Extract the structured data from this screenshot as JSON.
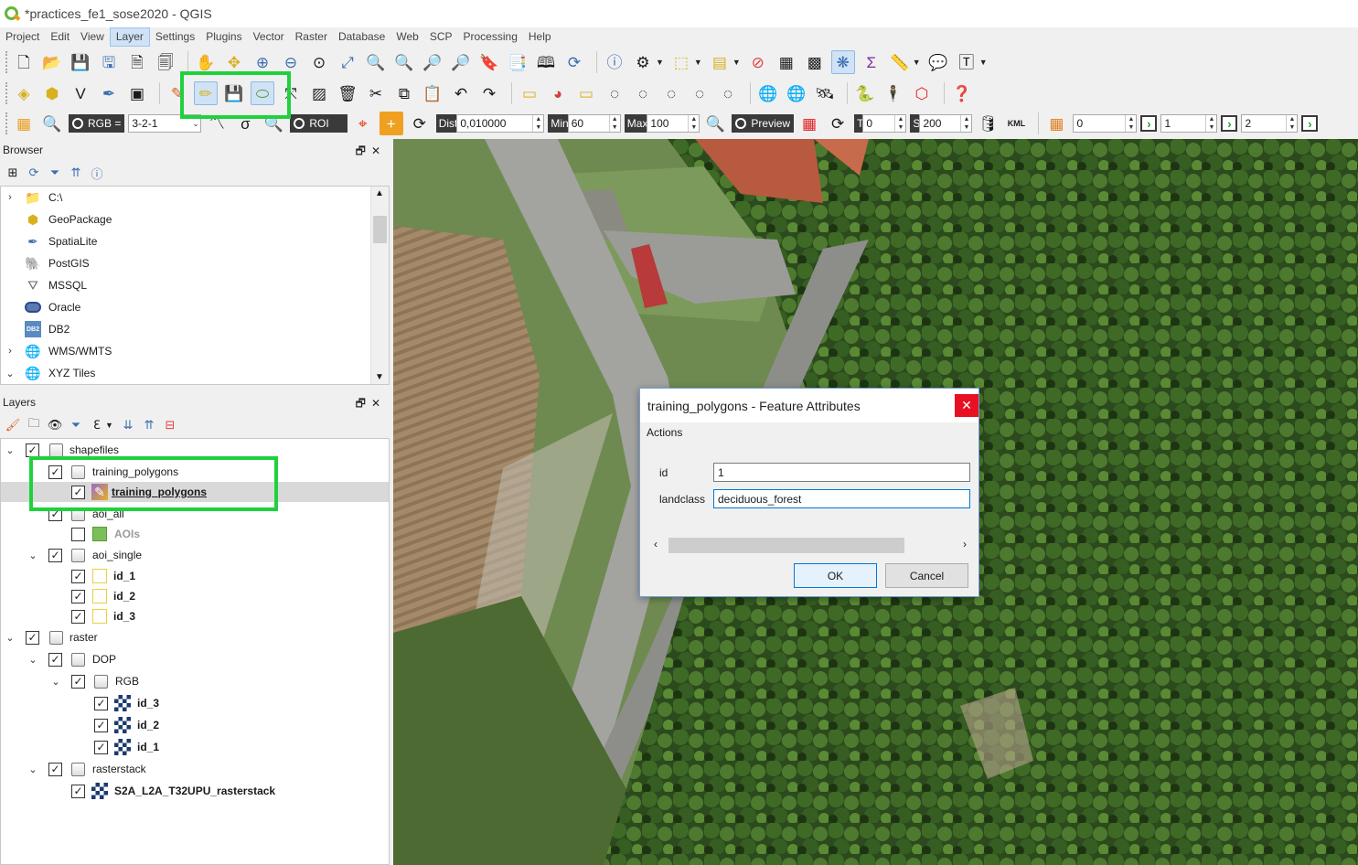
{
  "window": {
    "title": "*practices_fe1_sose2020 - QGIS"
  },
  "menu": [
    "Project",
    "Edit",
    "View",
    "Layer",
    "Settings",
    "Plugins",
    "Vector",
    "Raster",
    "Database",
    "Web",
    "SCP",
    "Processing",
    "Help"
  ],
  "menu_active": "Layer",
  "scp_toolbar": {
    "rgb_label": "RGB =",
    "rgb_value": "3-2-1",
    "roi_label": "ROI",
    "dist_label": "Dist",
    "dist_value": "0,010000",
    "min_label": "Min",
    "min_value": "60",
    "max_label": "Max",
    "max_value": "100",
    "preview_label": "Preview",
    "t_label": "T",
    "t_value": "0",
    "s_label": "S",
    "s_value": "200",
    "kml_label": "KML",
    "band_values": [
      "0",
      "1",
      "2"
    ]
  },
  "browser": {
    "title": "Browser",
    "items": [
      {
        "label": "C:\\",
        "icon": "folder-icon",
        "expander": "›"
      },
      {
        "label": "GeoPackage",
        "icon": "geopackage-icon",
        "expander": ""
      },
      {
        "label": "SpatiaLite",
        "icon": "spatialite-icon",
        "expander": ""
      },
      {
        "label": "PostGIS",
        "icon": "postgis-icon",
        "expander": ""
      },
      {
        "label": "MSSQL",
        "icon": "mssql-icon",
        "expander": ""
      },
      {
        "label": "Oracle",
        "icon": "oracle-icon",
        "expander": ""
      },
      {
        "label": "DB2",
        "icon": "db2-icon",
        "expander": ""
      },
      {
        "label": "WMS/WMTS",
        "icon": "globe-icon",
        "expander": "›"
      },
      {
        "label": "XYZ Tiles",
        "icon": "globe-icon",
        "expander": "⌄"
      }
    ],
    "db2_badge": "DB2"
  },
  "layers": {
    "title": "Layers",
    "tree": {
      "shapefiles": "shapefiles",
      "training_group": "training_polygons",
      "training_layer": "training_polygons",
      "aoi_all": "aoi_all",
      "aois": "AOIs",
      "aoi_single": "aoi_single",
      "aoi_ids": [
        "id_1",
        "id_2",
        "id_3"
      ],
      "raster": "raster",
      "dop": "DOP",
      "rgb": "RGB",
      "rgb_ids": [
        "id_3",
        "id_2",
        "id_1"
      ],
      "rasterstack": "rasterstack",
      "rasterstack_layer": "S2A_L2A_T32UPU_rasterstack"
    },
    "check_mark": "✓"
  },
  "dialog": {
    "title": "training_polygons - Feature Attributes",
    "actions_label": "Actions",
    "fields": [
      {
        "label": "id",
        "value": "1"
      },
      {
        "label": "landclass",
        "value": "deciduous_forest"
      }
    ],
    "ok_label": "OK",
    "cancel_label": "Cancel",
    "close_glyph": "✕"
  },
  "colors": {
    "highlight": "#1ed23c",
    "selection": "#cfe2f6",
    "close_red": "#e81123"
  }
}
